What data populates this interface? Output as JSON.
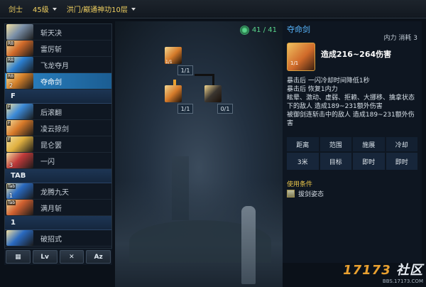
{
  "header": {
    "class_label": "剑士",
    "level_label": "45级",
    "school_label": "洪门/巅通神功10层"
  },
  "skill_list": {
    "rows": [
      {
        "type": "skill",
        "name": "斩天决",
        "key": "",
        "count": "",
        "color": "#7a8fa8"
      },
      {
        "type": "skill",
        "name": "雷厉斩",
        "key": "RB",
        "count": "",
        "color": "#d06a2a"
      },
      {
        "type": "skill",
        "name": "飞龙夺月",
        "key": "RB",
        "count": "",
        "color": "#2c7fd0"
      },
      {
        "type": "skill",
        "name": "夺命剑",
        "key": "RB",
        "count": "2",
        "color": "#d4802a",
        "active": true
      },
      {
        "type": "section",
        "name": "F"
      },
      {
        "type": "skill",
        "name": "后滚翻",
        "key": "F",
        "count": "",
        "color": "#3c8ad8"
      },
      {
        "type": "skill",
        "name": "凌云掠剑",
        "key": "F",
        "count": "",
        "color": "#d87a2a"
      },
      {
        "type": "skill",
        "name": "昆仑罢",
        "key": "F",
        "count": "",
        "color": "#e0b040"
      },
      {
        "type": "skill",
        "name": "一闪",
        "key": "",
        "count": "3",
        "color": "#c03a3a"
      },
      {
        "type": "section",
        "name": "TAB"
      },
      {
        "type": "skill",
        "name": "龙腾九天",
        "key": "Tab",
        "count": "1",
        "color": "#2a6ac0"
      },
      {
        "type": "skill",
        "name": "满月斩",
        "key": "Tab",
        "count": "",
        "color": "#d06030"
      },
      {
        "type": "section",
        "name": "1"
      },
      {
        "type": "skill",
        "name": "破招式",
        "key": "",
        "count": "",
        "color": "#2a6ac0"
      }
    ],
    "toolbar": [
      "▦",
      "Lv",
      "✕",
      "Az"
    ]
  },
  "tree": {
    "points": "41 / 41",
    "nodes": [
      {
        "level": "1/1",
        "sub": "1/1",
        "color": "#d47a2a"
      },
      {
        "level": "1/1",
        "sub": "",
        "color": "#d47a2a"
      },
      {
        "level": "0/1",
        "sub": "",
        "color": "#3a3530"
      }
    ]
  },
  "detail": {
    "title": "夺命剑",
    "mp_label": "内力 消耗 3",
    "icon_sub": "1/1",
    "damage": "造成216~264伤害",
    "desc": [
      "暴击后 一闪冷却时间降低1秒",
      "暴击后 恢复1内力",
      "眩晕、激动、虚弱、拒赖、大挪移、擒拿状态",
      "下的敌人 造成189~231额外伤害",
      "被御剑连斩击中的敌人 造成189~231额外伤",
      "害"
    ],
    "stats_headers": [
      "距离",
      "范围",
      "施展",
      "冷却"
    ],
    "stats_values": [
      "3米",
      "目标",
      "即时",
      "即时"
    ],
    "cond_title": "使用条件",
    "cond_item": "拔剑姿态"
  },
  "watermark": {
    "brand_a": "17173",
    "brand_b": "社区",
    "site": "BBS.17173.COM"
  }
}
